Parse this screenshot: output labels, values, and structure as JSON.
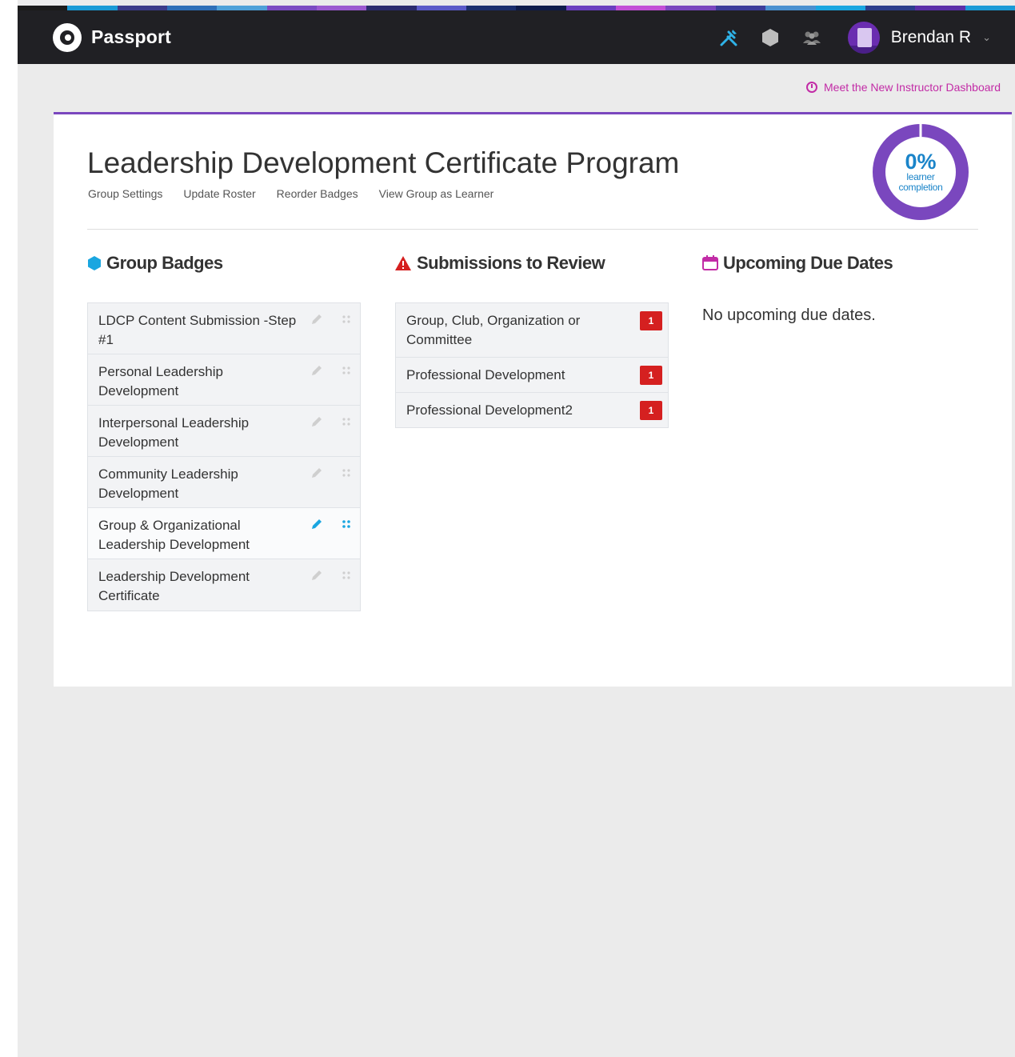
{
  "app": {
    "name": "Passport"
  },
  "colors": {
    "topbar": "#202024",
    "accent_purple": "#7a47be",
    "link_magenta": "#c22ba6",
    "completion_blue": "#1a84c9",
    "alert_red": "#d52020",
    "active_blue": "#1aa6e0"
  },
  "header": {
    "icons": [
      "tools-icon",
      "badge-hexagon-icon",
      "group-people-icon"
    ],
    "user": {
      "name": "Brendan R"
    }
  },
  "dashboard_link": {
    "label": "Meet the New Instructor Dashboard"
  },
  "page": {
    "title": "Leadership Development Certificate Program",
    "sublinks": [
      "Group Settings",
      "Update Roster",
      "Reorder Badges",
      "View Group as Learner"
    ]
  },
  "completion": {
    "percent_label": "0%",
    "percent_value": 0,
    "label_line1": "learner",
    "label_line2": "completion"
  },
  "columns": {
    "badges": {
      "title": "Group Badges"
    },
    "submissions": {
      "title": "Submissions to Review"
    },
    "due_dates": {
      "title": "Upcoming Due Dates",
      "empty_text": "No upcoming due dates."
    }
  },
  "badges": [
    {
      "label": "LDCP Content Submission -Step #1"
    },
    {
      "label": "Personal Leadership Development"
    },
    {
      "label": "Interpersonal Leadership Development"
    },
    {
      "label": "Community Leadership Development"
    },
    {
      "label": "Group & Organizational Leadership Development",
      "active": true
    },
    {
      "label": "Leadership Development Certificate"
    }
  ],
  "submissions": [
    {
      "label": "Group, Club, Organization or Committee",
      "count": "1"
    },
    {
      "label": "Professional Development",
      "count": "1"
    },
    {
      "label": "Professional Development2",
      "count": "1"
    }
  ]
}
